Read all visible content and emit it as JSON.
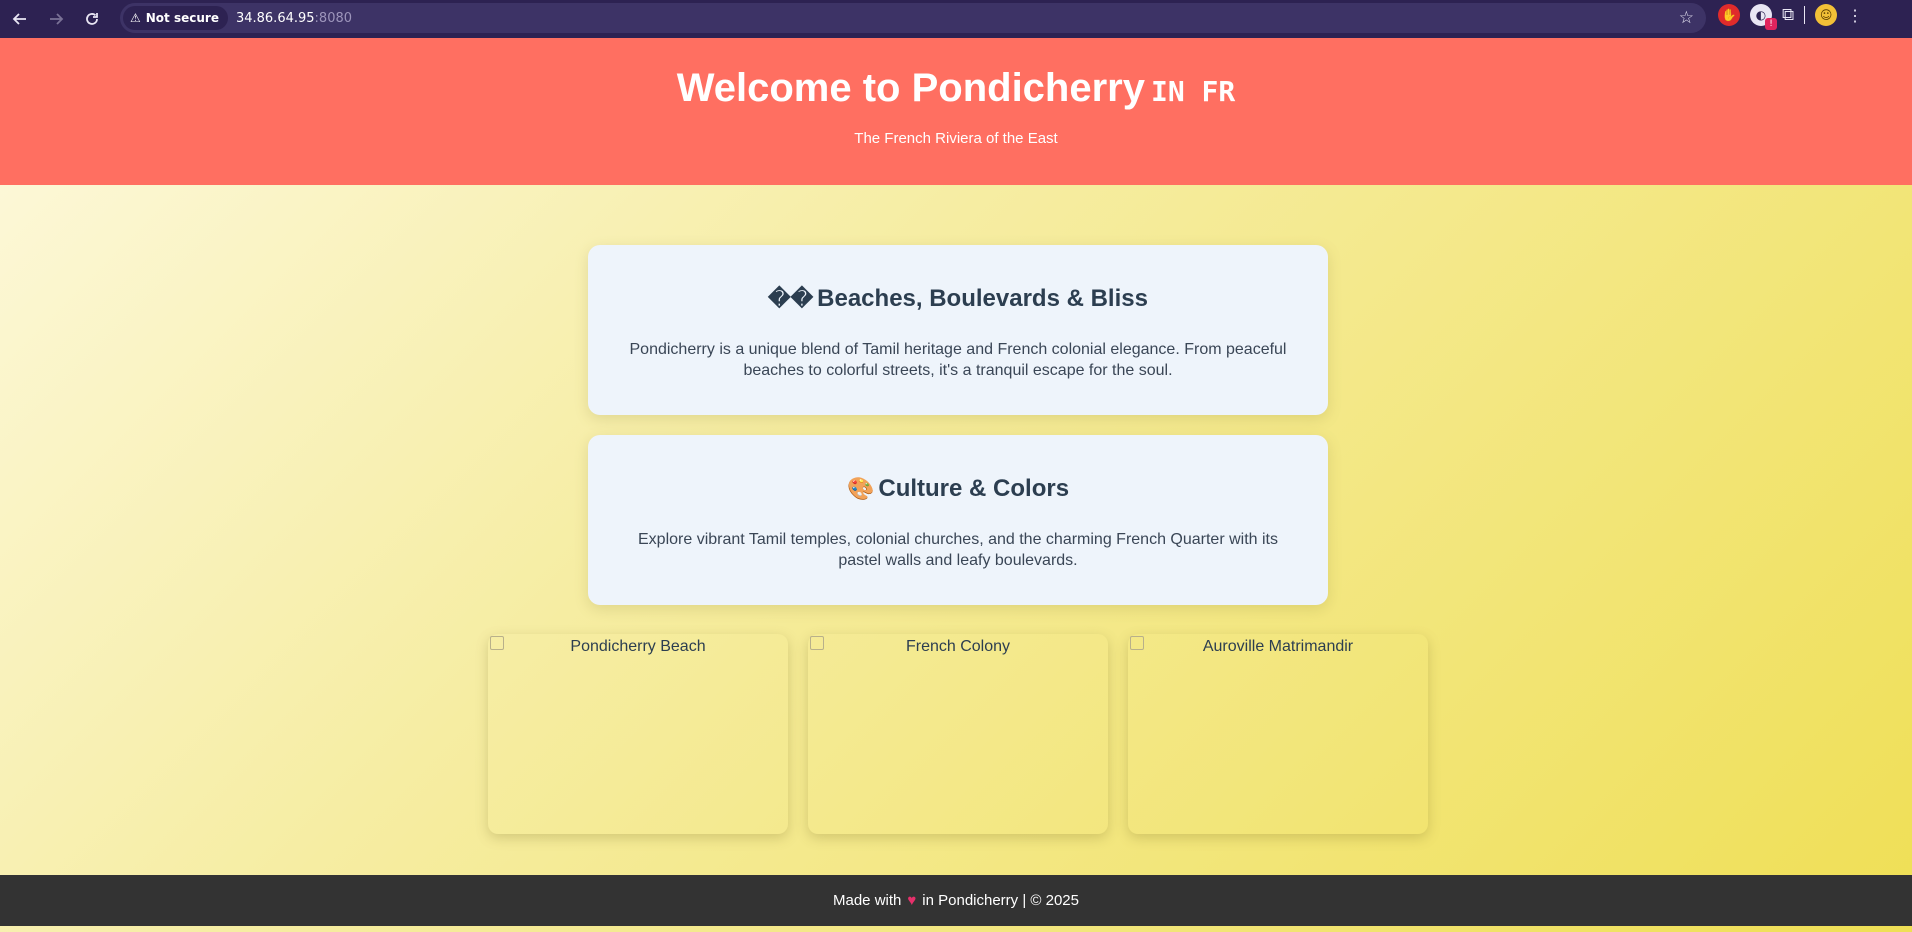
{
  "browser": {
    "back_icon": "arrow-left-icon",
    "forward_icon": "arrow-right-icon",
    "reload_icon": "reload-icon",
    "security_label": "Not secure",
    "url_host": "34.86.64.95",
    "url_port": ":8080",
    "bookmark_icon": "star-icon"
  },
  "header": {
    "title": "Welcome to Pondicherry",
    "flags": "IN FR",
    "subtitle": "The French Riviera of the East",
    "background_color": "#ff6f61"
  },
  "cards": [
    {
      "emoji": "��",
      "title": "Beaches, Boulevards & Bliss",
      "text": "Pondicherry is a unique blend of Tamil heritage and French colonial elegance. From peaceful beaches to colorful streets, it's a tranquil escape for the soul."
    },
    {
      "emoji": "🎨",
      "title": "Culture & Colors",
      "text": "Explore vibrant Tamil temples, colonial churches, and the charming French Quarter with its pastel walls and leafy boulevards."
    }
  ],
  "gallery": [
    {
      "alt": "Pondicherry Beach"
    },
    {
      "alt": "French Colony"
    },
    {
      "alt": "Auroville Matrimandir"
    }
  ],
  "footer": {
    "prefix": "Made with",
    "heart": "♥",
    "suffix": "in Pondicherry | © 2025",
    "background_color": "#333333"
  }
}
